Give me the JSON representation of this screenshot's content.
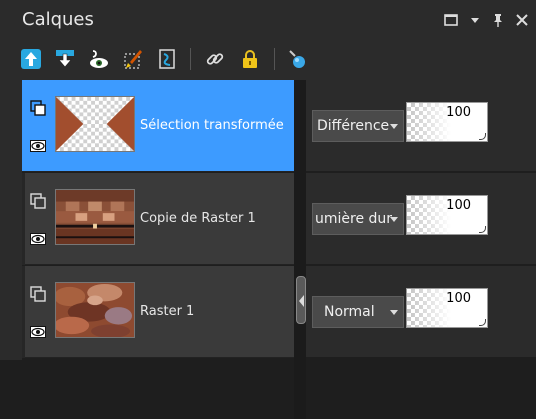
{
  "panel": {
    "title": "Calques",
    "controls": [
      "window-icon",
      "dropdown-icon",
      "pin-icon",
      "close-icon"
    ]
  },
  "toolbar": {
    "icons": [
      "move-up-icon",
      "move-down-icon",
      "visibility-icon",
      "brush-icon",
      "mask-icon",
      "link-icon",
      "lock-icon",
      "eyedropper-icon"
    ]
  },
  "layers": [
    {
      "name": "Sélection transformée",
      "blend_mode": "Différence",
      "opacity": "100",
      "selected": true
    },
    {
      "name": "Copie de Raster 1",
      "blend_mode": "umière dur",
      "opacity": "100",
      "selected": false
    },
    {
      "name": "Raster 1",
      "blend_mode": "Normal",
      "opacity": "100",
      "selected": false
    }
  ],
  "colors": {
    "selection": "#3d9bff",
    "panel_bg": "#2b2b2b",
    "row_bg": "#3a3a3a"
  }
}
